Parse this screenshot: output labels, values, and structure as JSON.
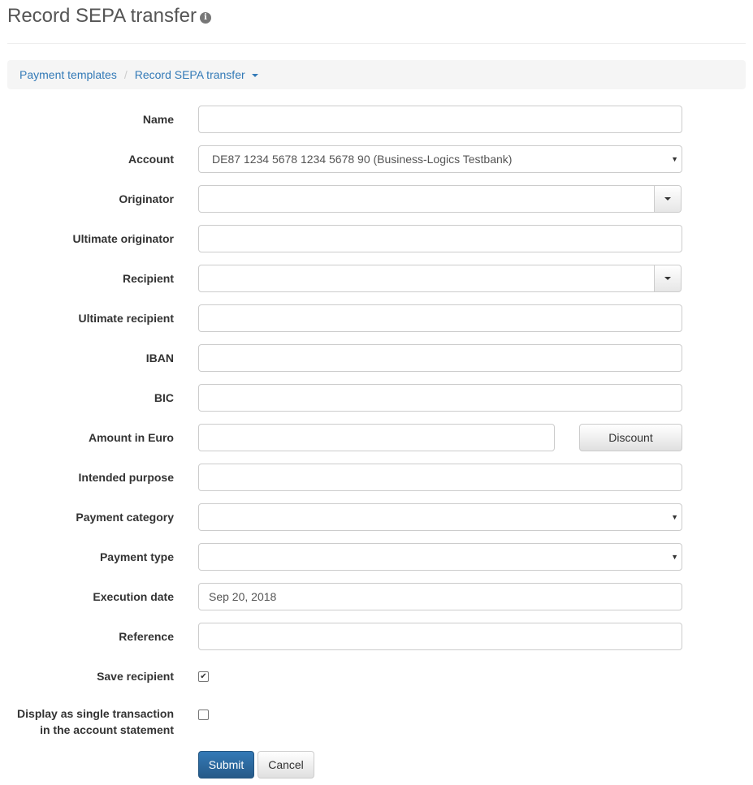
{
  "header": {
    "title": "Record SEPA transfer",
    "info_icon": "info-circle-icon"
  },
  "breadcrumb": {
    "items": [
      {
        "label": "Payment templates"
      },
      {
        "label": "Record SEPA transfer",
        "has_dropdown": true
      }
    ],
    "separator": "/"
  },
  "form": {
    "name": {
      "label": "Name",
      "value": ""
    },
    "account": {
      "label": "Account",
      "value": "DE87 1234 5678 1234 5678 90 (Business-Logics Testbank)"
    },
    "originator": {
      "label": "Originator",
      "value": ""
    },
    "ultimate_originator": {
      "label": "Ultimate originator",
      "value": ""
    },
    "recipient": {
      "label": "Recipient",
      "value": ""
    },
    "ultimate_recipient": {
      "label": "Ultimate recipient",
      "value": ""
    },
    "iban": {
      "label": "IBAN",
      "value": ""
    },
    "bic": {
      "label": "BIC",
      "value": ""
    },
    "amount": {
      "label": "Amount in Euro",
      "value": "",
      "discount_label": "Discount"
    },
    "intended_purpose": {
      "label": "Intended purpose",
      "value": ""
    },
    "payment_category": {
      "label": "Payment category",
      "value": ""
    },
    "payment_type": {
      "label": "Payment type",
      "value": ""
    },
    "execution_date": {
      "label": "Execution date",
      "value": "Sep 20, 2018"
    },
    "reference": {
      "label": "Reference",
      "value": ""
    },
    "save_recipient": {
      "label": "Save recipient",
      "checked": true
    },
    "single_transaction": {
      "label_line1": "Display as single transaction",
      "label_line2": "in the account statement",
      "checked": false
    }
  },
  "actions": {
    "submit_label": "Submit",
    "cancel_label": "Cancel"
  },
  "colors": {
    "link": "#337ab7",
    "primary": "#337ab7",
    "border": "#cccccc",
    "breadcrumb_bg": "#f5f5f5"
  }
}
